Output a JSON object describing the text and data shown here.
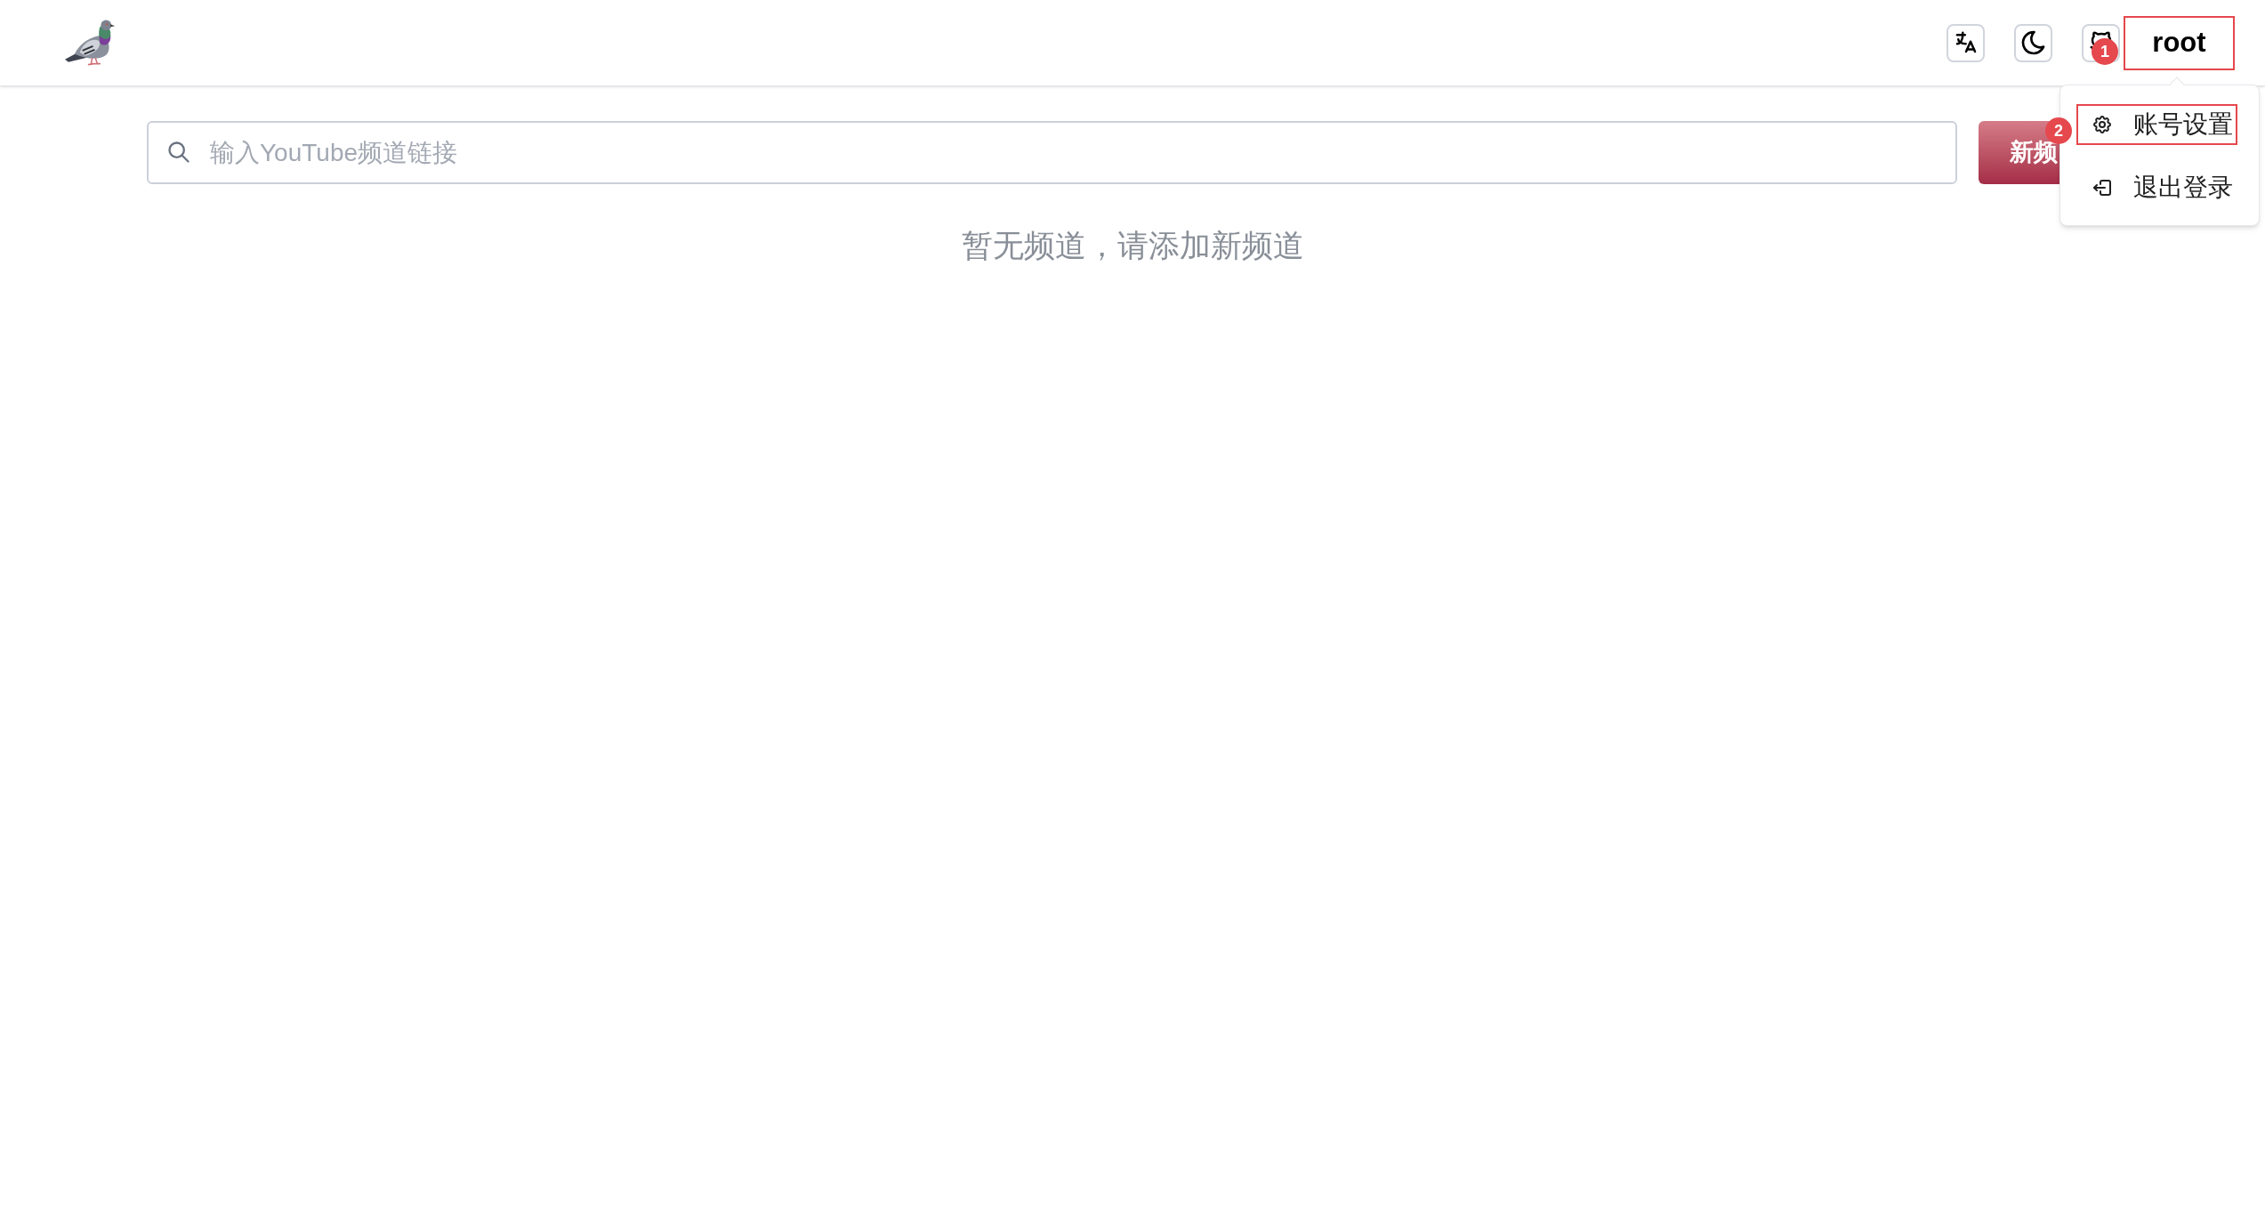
{
  "header": {
    "user_menu": {
      "label": "root",
      "annotation": "1",
      "expanded": true,
      "items": [
        {
          "kind": "settings",
          "label": "账号设置",
          "annotation": "2"
        },
        {
          "kind": "logout",
          "label": "退出登录"
        }
      ]
    }
  },
  "search": {
    "placeholder": "输入YouTube频道链接"
  },
  "add_button": {
    "label": "新频"
  },
  "empty_message": "暂无频道，请添加新频道"
}
